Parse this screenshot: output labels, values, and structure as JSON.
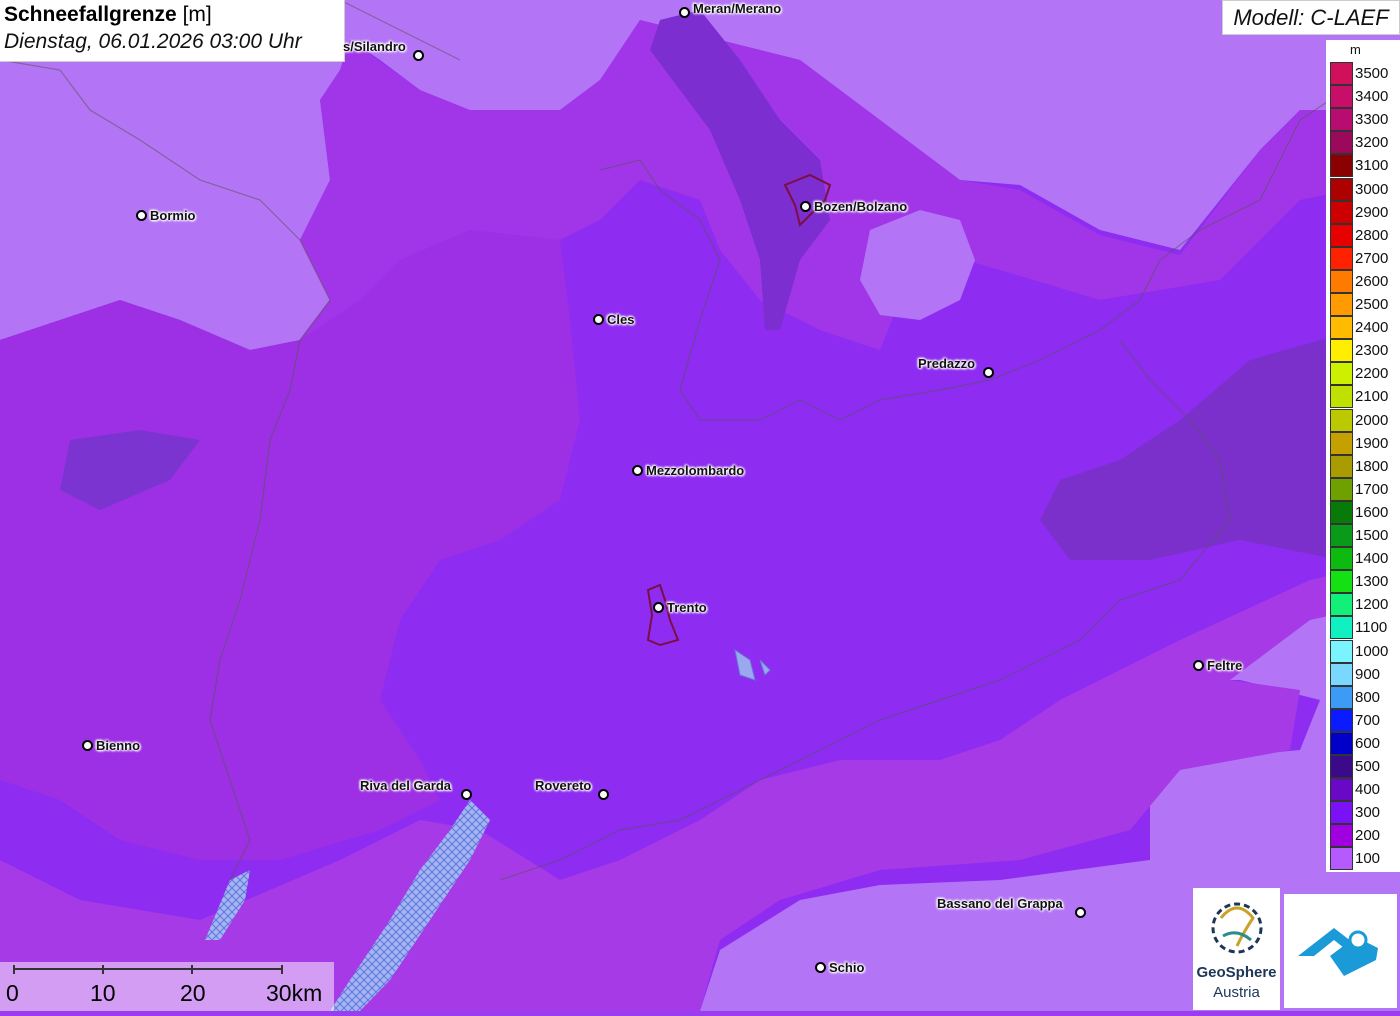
{
  "header": {
    "title_bold": "Schneefallgrenze",
    "title_unit": "[m]",
    "subtitle": "Dienstag, 06.01.2026 03:00 Uhr"
  },
  "model_label": "Modell: C-LAEF",
  "legend": {
    "unit": "m",
    "entries": [
      {
        "label": "3500",
        "color": "#d1105c"
      },
      {
        "label": "3400",
        "color": "#c70f6a"
      },
      {
        "label": "3300",
        "color": "#b80c70"
      },
      {
        "label": "3200",
        "color": "#9b0a5a"
      },
      {
        "label": "3100",
        "color": "#8b0000"
      },
      {
        "label": "3000",
        "color": "#ad0000"
      },
      {
        "label": "2900",
        "color": "#cc0000"
      },
      {
        "label": "2800",
        "color": "#e60000"
      },
      {
        "label": "2700",
        "color": "#ff2200"
      },
      {
        "label": "2600",
        "color": "#ff7a00"
      },
      {
        "label": "2500",
        "color": "#ff9a00"
      },
      {
        "label": "2400",
        "color": "#ffbb00"
      },
      {
        "label": "2300",
        "color": "#ffee00"
      },
      {
        "label": "2200",
        "color": "#ccf000"
      },
      {
        "label": "2100",
        "color": "#bfe000"
      },
      {
        "label": "2000",
        "color": "#bcc800"
      },
      {
        "label": "1900",
        "color": "#c4a000"
      },
      {
        "label": "1800",
        "color": "#a89c00"
      },
      {
        "label": "1700",
        "color": "#6ea000"
      },
      {
        "label": "1600",
        "color": "#087a08"
      },
      {
        "label": "1500",
        "color": "#0a9a1a"
      },
      {
        "label": "1400",
        "color": "#0cba10"
      },
      {
        "label": "1300",
        "color": "#14e014"
      },
      {
        "label": "1200",
        "color": "#12f07a"
      },
      {
        "label": "1100",
        "color": "#10f0c0"
      },
      {
        "label": "1000",
        "color": "#7af5ff"
      },
      {
        "label": "900",
        "color": "#7ad8ff"
      },
      {
        "label": "800",
        "color": "#3c9cf5"
      },
      {
        "label": "700",
        "color": "#0a1cff"
      },
      {
        "label": "600",
        "color": "#0000c8"
      },
      {
        "label": "500",
        "color": "#3a0a8a"
      },
      {
        "label": "400",
        "color": "#6a08c8"
      },
      {
        "label": "300",
        "color": "#7a12f5"
      },
      {
        "label": "200",
        "color": "#a000e0"
      },
      {
        "label": "100",
        "color": "#b45aff"
      }
    ]
  },
  "cities": [
    {
      "name": "Meran/Merano"
    },
    {
      "name": "s/Silandro"
    },
    {
      "name": "Bormio"
    },
    {
      "name": "Bozen/Bolzano"
    },
    {
      "name": "Cles"
    },
    {
      "name": "Predazzo"
    },
    {
      "name": "Mezzolombardo"
    },
    {
      "name": "Trento"
    },
    {
      "name": "Feltre"
    },
    {
      "name": "Bienno"
    },
    {
      "name": "Riva del Garda"
    },
    {
      "name": "Rovereto"
    },
    {
      "name": "Bassano del Grappa"
    },
    {
      "name": "Schio"
    }
  ],
  "scale_bar": {
    "labels": [
      "0",
      "10",
      "20",
      "30km"
    ]
  },
  "logos": {
    "geosphere_line1": "GeoSphere",
    "geosphere_line2": "Austria"
  }
}
